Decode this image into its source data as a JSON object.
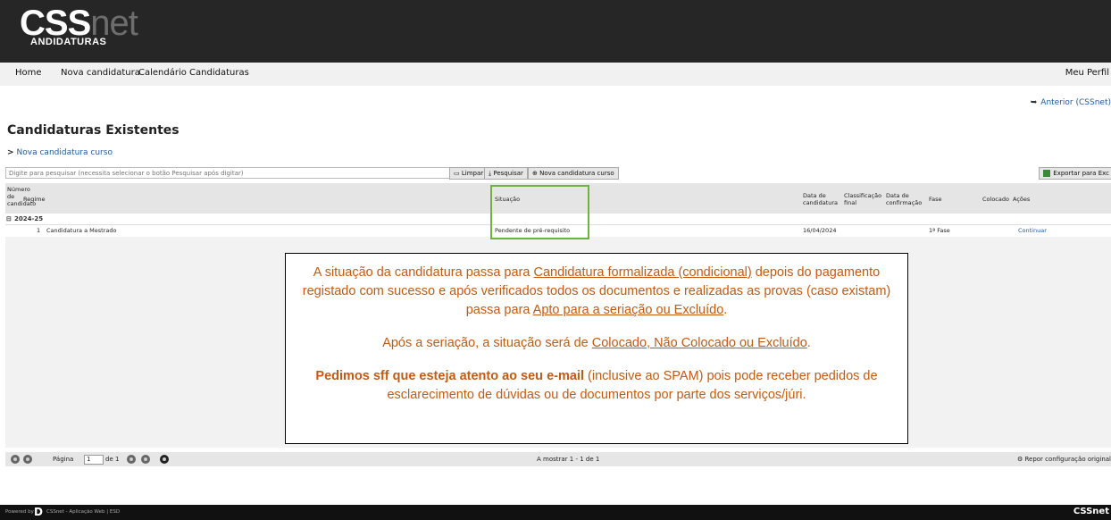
{
  "brand": {
    "logo_main": "CSS",
    "logo_net": "net",
    "logo_sub": "ANDIDATURAS"
  },
  "nav": {
    "items": [
      "Home",
      "Nova candidatura",
      "Calendário Candidaturas"
    ],
    "profile": "Meu Perfil"
  },
  "back_link": "Anterior (CSSnet)",
  "page_title": "Candidaturas Existentes",
  "new_course_link": "Nova candidatura curso",
  "toolbar": {
    "search_placeholder": "Digite para pesquisar (necessita selecionar o botão Pesquisar após digitar)",
    "clear": "Limpar",
    "search": "Pesquisar",
    "new_course": "Nova candidatura curso",
    "export": "Exportar para Exc"
  },
  "table": {
    "headers": {
      "numero": "Número de candidato",
      "regime": "Regime",
      "situacao": "Situação",
      "data_candidatura": "Data de candidatura",
      "classificacao": "Classificação final",
      "data_confirmacao": "Data de confirmação",
      "fase": "Fase",
      "colocado": "Colocado",
      "acoes": "Ações"
    },
    "group": "2024-25",
    "row": {
      "numero": "1",
      "regime": "Candidatura a Mestrado",
      "situacao": "Pendente de pré-requisito",
      "data_candidatura": "16/04/2024",
      "fase": "1ª Fase",
      "acao": "Continuar"
    }
  },
  "info": {
    "p1_a": "A situação da candidatura passa para ",
    "p1_link1": "Candidatura formalizada (condicional)",
    "p1_b": " depois do pagamento registado com sucesso e após verificados todos os documentos e realizadas as provas (caso existam) passa para ",
    "p1_link2": "Apto para a seriação ou Excluído",
    "p1_c": ".",
    "p2_a": "Após a seriação, a situação será de ",
    "p2_link": "Colocado, Não Colocado ou Excluído",
    "p2_b": ".",
    "p3_bold": "Pedimos sff que esteja atento ao seu e-mail",
    "p3_rest": " (inclusive ao SPAM) pois pode receber pedidos de esclarecimento de dúvidas ou de documentos por parte dos serviços/júri."
  },
  "pager": {
    "label": "Página",
    "current": "1",
    "of": "de 1",
    "showing": "A mostrar 1 - 1 de 1",
    "reset": "Repor configuração original"
  },
  "footer": {
    "powered": "Powered by",
    "app": "CSSnet - Aplicação Web | ESD",
    "brand_right": "CSSnet"
  },
  "colors": {
    "header_bg": "#262626",
    "highlight": "#6db33f",
    "info_text": "#c55a11",
    "link": "#1f5aa0"
  }
}
